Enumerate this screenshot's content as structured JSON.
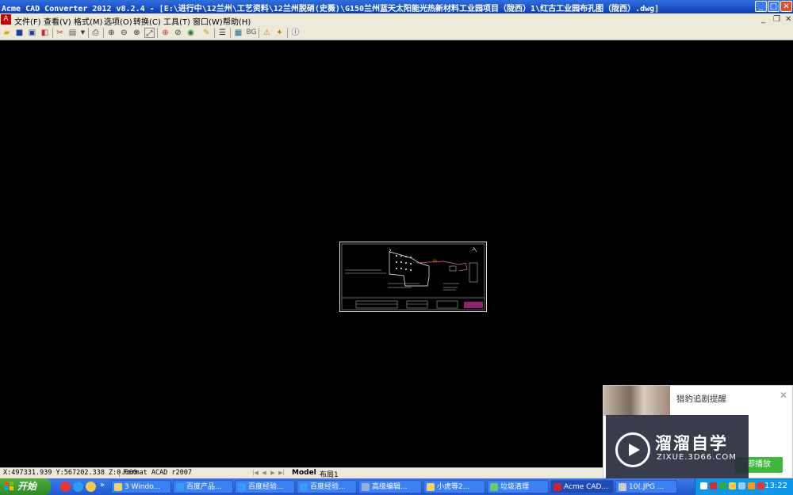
{
  "titlebar": {
    "title": "Acme CAD Converter 2012 v8.2.4 - [E:\\进行中\\12兰州\\工艺资料\\12兰州脱硝(史薇)\\G150兰州蓝天太阳能光热新材料工业园项目（陇西）1\\红古工业园布孔图（陇西）.dwg]",
    "minimize": "_",
    "maximize": "□",
    "close": "✕"
  },
  "menubar": {
    "items": [
      "文件(F)",
      "查看(V)",
      "格式(M)",
      "选项(O)",
      "转换(C)",
      "工具(T)",
      "窗口(W)",
      "帮助(H)"
    ],
    "mdi_minimize": "_",
    "mdi_restore": "❐",
    "mdi_close": "✕"
  },
  "toolbar": {
    "bg_label": "BG",
    "icons": [
      "open-icon",
      "save-icon",
      "save-as-icon",
      "convert-icon",
      "cut-icon",
      "batch-icon",
      "print-icon",
      "zoom-in-icon",
      "zoom-out-icon",
      "zoom-window-icon",
      "zoom-extents-icon",
      "find-icon",
      "search-icon",
      "eye-icon",
      "brush-icon",
      "layers-icon",
      "background-icon",
      "bg-label",
      "warning-icon",
      "star-icon",
      "info-icon"
    ]
  },
  "statusbar": {
    "coords": "X:497331.939 Y:567202.338 Z:0.000",
    "format": "Format ACAD r2007",
    "tabs": [
      "Model",
      "布局1"
    ]
  },
  "popup": {
    "title": "猎豹追剧提醒",
    "button": "即播放",
    "close": "✕"
  },
  "watermark": {
    "brand": "溜溜自学",
    "url": "ZIXUE.3D66.COM"
  },
  "taskbar": {
    "start": "开始",
    "quicklaunch_more": "»",
    "tasks": [
      {
        "label": "3 Windo...",
        "active": false
      },
      {
        "label": "百度产品...",
        "active": false
      },
      {
        "label": "百度经验...",
        "active": false
      },
      {
        "label": "百度经验...",
        "active": false
      },
      {
        "label": "高级编辑...",
        "active": false
      },
      {
        "label": "小虎等2...",
        "active": false
      },
      {
        "label": "垃圾清理",
        "active": false
      },
      {
        "label": "Acme CAD...",
        "active": true
      },
      {
        "label": "10(.JPG ...",
        "active": false
      }
    ],
    "clock": "13:22"
  },
  "colors": {
    "titlebar": "#0a3fb0",
    "canvas": "#000000",
    "taskbar": "#1f58d0",
    "start": "#2e8a22",
    "popup_button": "#3cb83c"
  }
}
